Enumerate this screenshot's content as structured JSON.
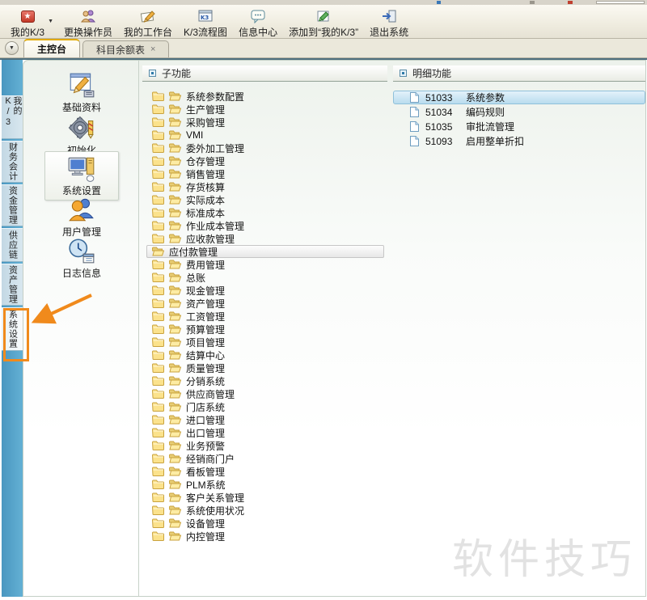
{
  "titlebar": {
    "note": ""
  },
  "toolbar": {
    "caret_glyph": "▼",
    "items": [
      {
        "label": "我的K/3",
        "icon": "my-k3-star-icon"
      },
      {
        "label": "更换操作员",
        "icon": "switch-operator-icon"
      },
      {
        "label": "我的工作台",
        "icon": "my-workbench-icon"
      },
      {
        "label": "K/3流程图",
        "icon": "k3-flowchart-icon"
      },
      {
        "label": "信息中心",
        "icon": "info-center-icon"
      },
      {
        "label": "添加到“我的K/3”",
        "icon": "add-to-my-k3-icon"
      },
      {
        "label": "退出系统",
        "icon": "exit-system-icon"
      }
    ]
  },
  "tabbar": {
    "dropdown_glyph": "▼",
    "tabs": [
      {
        "label": "主控台",
        "active": true
      },
      {
        "label": "科目余额表",
        "active": false,
        "close_glyph": "×"
      }
    ]
  },
  "sidebar": {
    "accent_color": "#4a97c0",
    "items": [
      {
        "label": "我的K/3"
      },
      {
        "label": "财务会计"
      },
      {
        "label": "资金管理"
      },
      {
        "label": "供应链"
      },
      {
        "label": "资产管理"
      },
      {
        "label": "系统设置",
        "annotated": true
      }
    ]
  },
  "modules": {
    "items": [
      {
        "label": "基础资料",
        "icon": "base-data-icon"
      },
      {
        "label": "初始化",
        "icon": "initialization-icon"
      },
      {
        "label": "系统设置",
        "icon": "system-settings-icon",
        "selected": true
      },
      {
        "label": "用户管理",
        "icon": "user-management-icon"
      },
      {
        "label": "日志信息",
        "icon": "log-info-icon"
      }
    ]
  },
  "subfunctions": {
    "title": "子功能",
    "items": [
      {
        "label": "系统参数配置"
      },
      {
        "label": "生产管理"
      },
      {
        "label": "采购管理"
      },
      {
        "label": "VMI"
      },
      {
        "label": "委外加工管理"
      },
      {
        "label": "仓存管理"
      },
      {
        "label": "销售管理"
      },
      {
        "label": "存货核算"
      },
      {
        "label": "实际成本"
      },
      {
        "label": "标准成本"
      },
      {
        "label": "作业成本管理"
      },
      {
        "label": "应收款管理"
      },
      {
        "label": "应付款管理",
        "selected": true
      },
      {
        "label": "费用管理"
      },
      {
        "label": "总账"
      },
      {
        "label": "现金管理"
      },
      {
        "label": "资产管理"
      },
      {
        "label": "工资管理"
      },
      {
        "label": "预算管理"
      },
      {
        "label": "项目管理"
      },
      {
        "label": "结算中心"
      },
      {
        "label": "质量管理"
      },
      {
        "label": "分销系统"
      },
      {
        "label": "供应商管理"
      },
      {
        "label": "门店系统"
      },
      {
        "label": "进口管理"
      },
      {
        "label": "出口管理"
      },
      {
        "label": "业务预警"
      },
      {
        "label": "经销商门户"
      },
      {
        "label": "看板管理"
      },
      {
        "label": "PLM系统"
      },
      {
        "label": "客户关系管理"
      },
      {
        "label": "系统使用状况"
      },
      {
        "label": "设备管理"
      },
      {
        "label": "内控管理"
      }
    ]
  },
  "details": {
    "title": "明细功能",
    "items": [
      {
        "code": "51033",
        "label": "系统参数",
        "selected": true
      },
      {
        "code": "51034",
        "label": "编码规则"
      },
      {
        "code": "51035",
        "label": "审批流管理"
      },
      {
        "code": "51093",
        "label": "启用整单折扣"
      }
    ]
  },
  "annotation": {
    "color": "#f08a1c",
    "target": "系统设置"
  },
  "watermark": "软件技巧"
}
